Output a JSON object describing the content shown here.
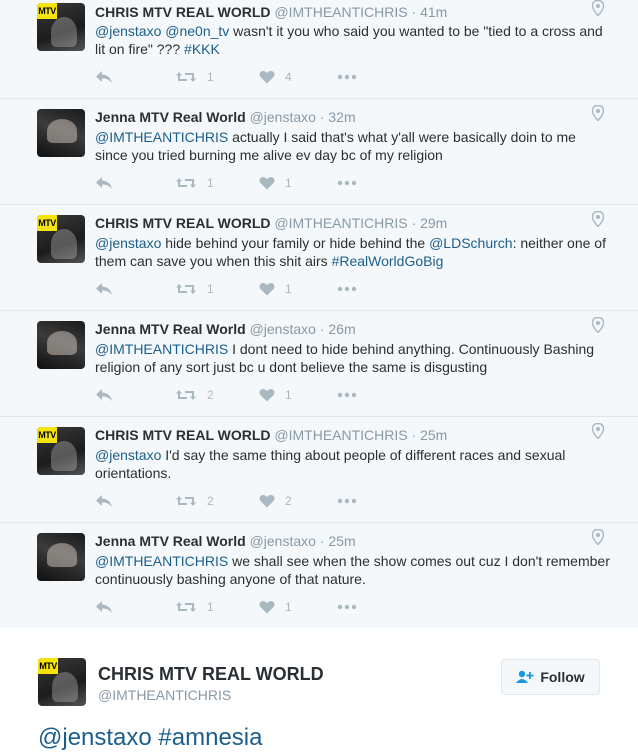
{
  "tweets": [
    {
      "author": "chris",
      "name": "CHRIS MTV REAL WORLD",
      "handle": "@IMTHEANTICHRIS",
      "sep": "·",
      "time": "41m",
      "text": [
        {
          "t": "mention",
          "v": "@jenstaxo"
        },
        {
          "t": "plain",
          "v": " "
        },
        {
          "t": "mention",
          "v": "@ne0n_tv"
        },
        {
          "t": "plain",
          "v": " wasn't it you who said you wanted to be \"tied to a cross and lit on fire\" ??? "
        },
        {
          "t": "hashtag",
          "v": "#KKK"
        }
      ],
      "retweets": "1",
      "likes": "4"
    },
    {
      "author": "jenna",
      "name": "Jenna MTV Real World",
      "handle": "@jenstaxo",
      "sep": "·",
      "time": "32m",
      "text": [
        {
          "t": "mention",
          "v": "@IMTHEANTICHRIS"
        },
        {
          "t": "plain",
          "v": " actually I said that's what y'all were basically doin to me since you tried burning me alive ev day bc of my religion"
        }
      ],
      "retweets": "1",
      "likes": "1"
    },
    {
      "author": "chris",
      "name": "CHRIS MTV REAL WORLD",
      "handle": "@IMTHEANTICHRIS",
      "sep": "·",
      "time": "29m",
      "text": [
        {
          "t": "mention",
          "v": "@jenstaxo"
        },
        {
          "t": "plain",
          "v": " hide behind your family or hide behind the "
        },
        {
          "t": "mention",
          "v": "@LDSchurch"
        },
        {
          "t": "plain",
          "v": ": neither one of them can save you when this shit airs "
        },
        {
          "t": "hashtag",
          "v": "#RealWorldGoBig"
        }
      ],
      "retweets": "1",
      "likes": "1"
    },
    {
      "author": "jenna",
      "name": "Jenna MTV Real World",
      "handle": "@jenstaxo",
      "sep": "·",
      "time": "26m",
      "text": [
        {
          "t": "mention",
          "v": "@IMTHEANTICHRIS"
        },
        {
          "t": "plain",
          "v": " I dont need to hide behind anything. Continuously Bashing religion of any sort just bc u dont believe the same is disgusting"
        }
      ],
      "retweets": "2",
      "likes": "1"
    },
    {
      "author": "chris",
      "name": "CHRIS MTV REAL WORLD",
      "handle": "@IMTHEANTICHRIS",
      "sep": "·",
      "time": "25m",
      "text": [
        {
          "t": "mention",
          "v": "@jenstaxo"
        },
        {
          "t": "plain",
          "v": " I'd say the same thing about people of different races and sexual orientations."
        }
      ],
      "retweets": "2",
      "likes": "2"
    },
    {
      "author": "jenna",
      "name": "Jenna MTV Real World",
      "handle": "@jenstaxo",
      "sep": "·",
      "time": "25m",
      "text": [
        {
          "t": "mention",
          "v": "@IMTHEANTICHRIS"
        },
        {
          "t": "plain",
          "v": " we shall see when the show comes out cuz I don't remember continuously bashing anyone of that nature."
        }
      ],
      "retweets": "1",
      "likes": "1"
    }
  ],
  "focus": {
    "name": "CHRIS MTV REAL WORLD",
    "handle": "@IMTHEANTICHRIS",
    "follow_label": "Follow",
    "text": "@jenstaxo #amnesia"
  },
  "avatar_badge": "MTV",
  "colors": {
    "link": "#1b5e8a",
    "muted": "#8899a6",
    "icon": "#aab8c2",
    "row_bg": "#f5f8fa",
    "badge": "#f5e30a"
  },
  "icons": {
    "reply": "reply-icon",
    "retweet": "retweet-icon",
    "like": "heart-icon",
    "more": "more-dots-icon",
    "location": "location-pin-icon",
    "follow": "add-user-icon"
  }
}
